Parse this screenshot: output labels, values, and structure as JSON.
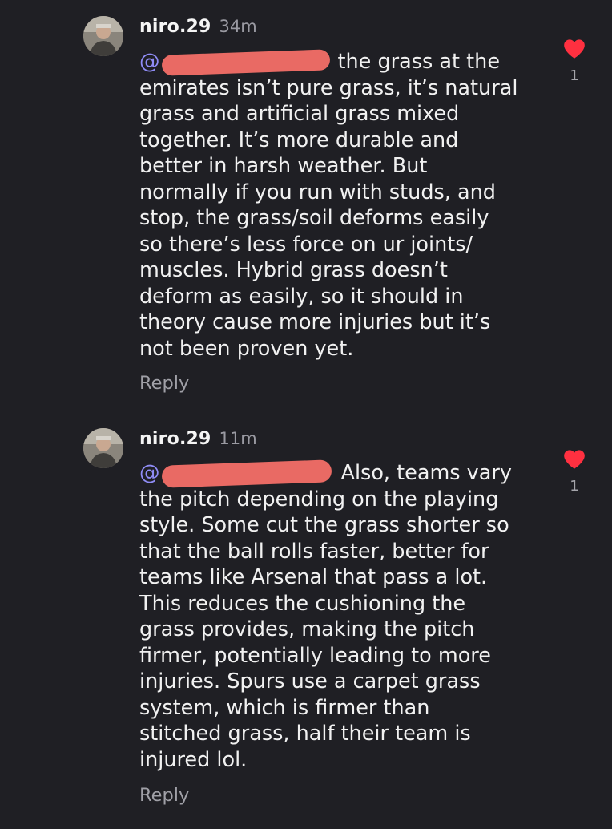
{
  "comments": [
    {
      "username": "niro.29",
      "time": "34m",
      "mention_prefix": "@",
      "lines": [
        "the grass at the",
        "emirates isn’t pure grass, it’s natural",
        "grass and artificial grass mixed",
        "together. It’s more durable and",
        "better in harsh weather. But",
        "normally if you run with studs, and",
        "stop, the grass/soil deforms easily",
        "so there’s less force on ur joints/",
        "muscles. Hybrid grass doesn’t",
        "deform as easily, so it should in",
        "theory cause more injuries but it’s",
        "not been proven yet."
      ],
      "reply_label": "Reply",
      "like_count": "1"
    },
    {
      "username": "niro.29",
      "time": "11m",
      "mention_prefix": "@",
      "lines": [
        "Also, teams vary",
        "the pitch depending on the playing",
        "style. Some cut the grass shorter so",
        "that the ball rolls faster, better for",
        "teams like Arsenal that pass a lot.",
        "This reduces the cushioning the",
        "grass provides, making the pitch",
        "firmer, potentially leading to more",
        "injuries. Spurs use a carpet grass",
        "system, which is firmer than",
        "stitched grass, half their team is",
        "injured lol."
      ],
      "reply_label": "Reply",
      "like_count": "1"
    }
  ],
  "colors": {
    "background": "#1f1f24",
    "text": "#f1f1f1",
    "muted": "#9a9aa2",
    "mention": "#8f8cf5",
    "heart": "#ff3040",
    "redaction": "#e96a64"
  },
  "icons": {
    "like": "heart-icon",
    "avatar": "avatar"
  }
}
